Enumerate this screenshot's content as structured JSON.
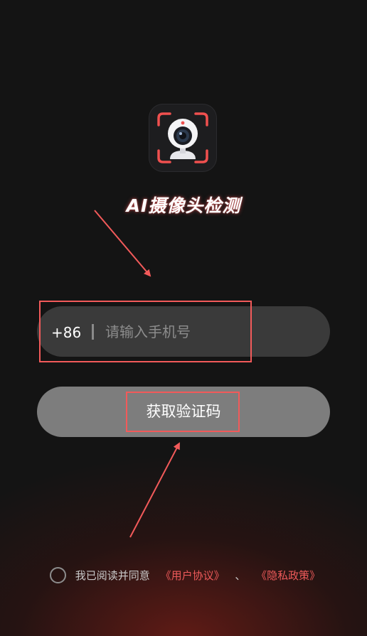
{
  "app": {
    "title": "AI摄像头检测",
    "logo_icon": "webcam-icon"
  },
  "login": {
    "country_code": "+86",
    "phone_placeholder": "请输入手机号",
    "get_code_label": "获取验证码"
  },
  "agreement": {
    "prefix": "我已阅读并同意",
    "user_agreement": "《用户协议》",
    "separator": "、",
    "privacy_policy": "《隐私政策》"
  },
  "colors": {
    "background": "#141414",
    "accent": "#f25a5a",
    "input_bg": "#3a3a3a",
    "button_bg": "#7d7d7d"
  }
}
